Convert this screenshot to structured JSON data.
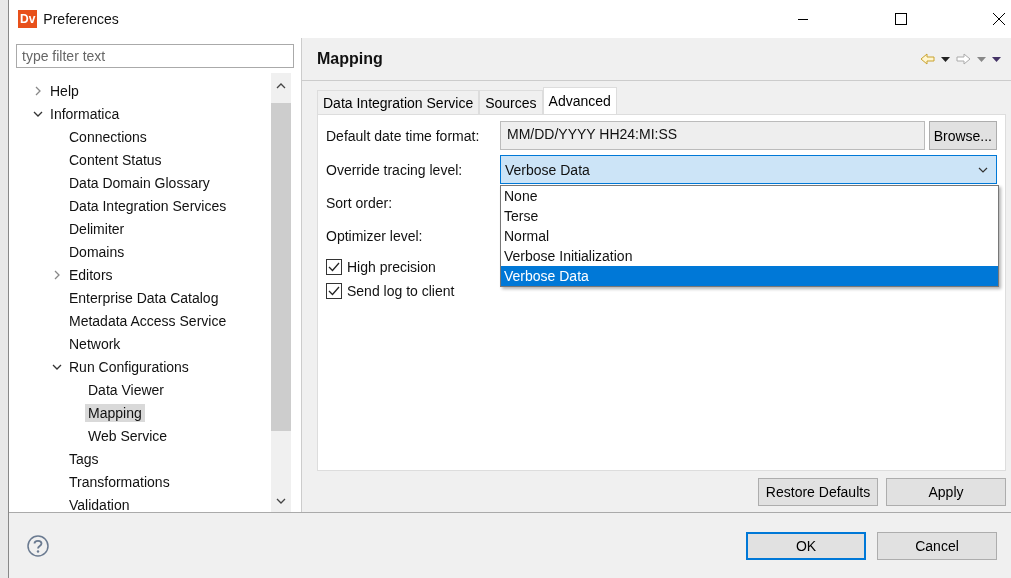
{
  "window": {
    "logo": "Dv",
    "title": "Preferences"
  },
  "filter": {
    "placeholder": "type filter text"
  },
  "tree": [
    {
      "label": "Help",
      "expanded": false,
      "selected": false
    },
    {
      "label": "Informatica",
      "expanded": true,
      "selected": false,
      "children": [
        {
          "label": "Connections",
          "selected": false
        },
        {
          "label": "Content Status",
          "selected": false
        },
        {
          "label": "Data Domain Glossary",
          "selected": false
        },
        {
          "label": "Data Integration Services",
          "selected": false
        },
        {
          "label": "Delimiter",
          "selected": false
        },
        {
          "label": "Domains",
          "selected": false
        },
        {
          "label": "Editors",
          "expanded": false,
          "selected": false
        },
        {
          "label": "Enterprise Data Catalog",
          "selected": false
        },
        {
          "label": "Metadata Access Service",
          "selected": false
        },
        {
          "label": "Network",
          "selected": false
        },
        {
          "label": "Run Configurations",
          "expanded": true,
          "selected": false,
          "children": [
            {
              "label": "Data Viewer",
              "selected": false
            },
            {
              "label": "Mapping",
              "selected": true
            },
            {
              "label": "Web Service",
              "selected": false
            }
          ]
        },
        {
          "label": "Tags",
          "selected": false
        },
        {
          "label": "Transformations",
          "selected": false
        },
        {
          "label": "Validation",
          "selected": false
        }
      ]
    }
  ],
  "page_title": "Mapping",
  "tabs": [
    {
      "label": "Data Integration Service",
      "selected": false
    },
    {
      "label": "Sources",
      "selected": false
    },
    {
      "label": "Advanced",
      "selected": true
    }
  ],
  "fields": [
    {
      "kind": "text",
      "label": "Default date time format:",
      "value": "MM/DD/YYYY HH24:MI:SS",
      "button": "Browse..."
    },
    {
      "kind": "combo",
      "label": "Override tracing level:",
      "value": "Verbose Data"
    },
    {
      "kind": "empty",
      "label": "Sort order:"
    },
    {
      "kind": "empty",
      "label": "Optimizer level:"
    }
  ],
  "checkboxes": [
    {
      "label": "High precision",
      "checked": true
    },
    {
      "label": "Send log to client",
      "checked": true
    }
  ],
  "dropdown": [
    {
      "label": "None",
      "selected": false
    },
    {
      "label": "Terse",
      "selected": false
    },
    {
      "label": "Normal",
      "selected": false
    },
    {
      "label": "Verbose Initialization",
      "selected": false
    },
    {
      "label": "Verbose Data",
      "selected": true
    }
  ],
  "page_buttons": [
    "Restore Defaults",
    "Apply"
  ],
  "dialog_buttons": [
    {
      "label": "OK",
      "default": true
    },
    {
      "label": "Cancel",
      "default": false
    }
  ]
}
